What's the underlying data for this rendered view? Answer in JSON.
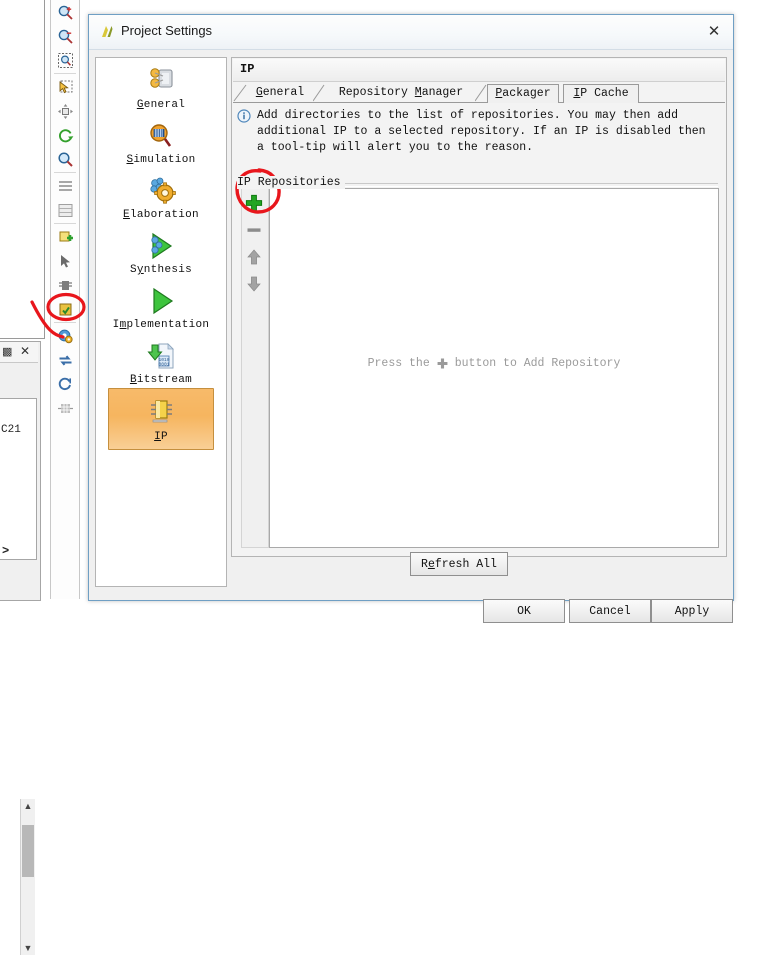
{
  "dialog": {
    "title": "Project Settings",
    "title_icon": "vivado-logo-icon",
    "close_icon": "close-icon",
    "buttons": {
      "ok": "OK",
      "cancel": "Cancel",
      "apply": "Apply"
    }
  },
  "categories": [
    {
      "label": "General",
      "label_html": "<u>G</u>eneral",
      "icon": "general-icon",
      "selected": false
    },
    {
      "label": "Simulation",
      "label_html": "<u>S</u>imulation",
      "icon": "simulation-icon",
      "selected": false
    },
    {
      "label": "Elaboration",
      "label_html": "<u>E</u>laboration",
      "icon": "elaboration-icon",
      "selected": false
    },
    {
      "label": "Synthesis",
      "label_html": "S<u>y</u>nthesis",
      "icon": "synthesis-icon",
      "selected": false
    },
    {
      "label": "Implementation",
      "label_html": "I<u>m</u>plementation",
      "icon": "implementation-icon",
      "selected": false
    },
    {
      "label": "Bitstream",
      "label_html": "<u>B</u>itstream",
      "icon": "bitstream-icon",
      "selected": false
    },
    {
      "label": "IP",
      "label_html": "<u>I</u>P",
      "icon": "ip-icon",
      "selected": true
    }
  ],
  "content": {
    "header_title": "IP",
    "tabs": [
      {
        "label": "General",
        "label_html": "<u>G</u>eneral",
        "active": false
      },
      {
        "label": "Repository Manager",
        "label_html": "Repository <u>M</u>anager",
        "active": true
      },
      {
        "label": "Packager",
        "label_html": "<u>P</u>ackager",
        "active": false
      },
      {
        "label": "IP Cache",
        "label_html": "<u>I</u>P Cache",
        "active": false
      }
    ],
    "info_icon": "info-icon",
    "info_text": "Add directories to the list of repositories. You may then add additional IP to a selected repository. If an IP is disabled then a tool-tip will alert you to the reason.",
    "group_label": "IP Repositories",
    "toolbar": [
      {
        "name": "add-repository-button",
        "icon": "plus-icon",
        "color": "#22a522",
        "enabled": true
      },
      {
        "name": "remove-repository-button",
        "icon": "minus-icon",
        "color": "#8c8c8c",
        "enabled": false
      },
      {
        "name": "move-up-button",
        "icon": "arrow-up-icon",
        "color": "#9a9a9a",
        "enabled": false
      },
      {
        "name": "move-down-button",
        "icon": "arrow-down-icon",
        "color": "#9a9a9a",
        "enabled": false
      }
    ],
    "empty_message_prefix": "Press the",
    "empty_message_icon": "plus-icon",
    "empty_message_suffix": "button to Add Repository",
    "refresh_button": "Refresh All",
    "refresh_button_html": "R<u>e</u>fresh All"
  },
  "background": {
    "toolbar_icons": [
      "zoom-in-icon",
      "zoom-out-icon",
      "zoom-fit-icon",
      "select-area-icon",
      "expand-all-icon",
      "refresh-icon",
      "search-icon",
      "list-view-icon",
      "table-view-icon",
      "add-module-icon",
      "pointer-icon",
      "hierarchy-icon",
      "highlight-icon",
      "settings-gear-icon",
      "swap-icon",
      "reload-icon",
      "grid-icon"
    ],
    "panel_close_icon": "close-icon",
    "panel_tab_icon": "panel-icon",
    "code_fragment": "C21",
    "arrow_fragment": ">",
    "scroll_up_icon": "chevron-up-icon",
    "scroll_down_icon": "chevron-down-icon"
  },
  "annotations": {
    "color": "#e8161c",
    "items": [
      {
        "name": "annotation-circle-add-button",
        "shape": "hand-drawn-ellipse"
      },
      {
        "name": "annotation-circle-settings-icon",
        "shape": "hand-drawn-ellipse"
      },
      {
        "name": "annotation-check-mark",
        "shape": "hand-drawn-check"
      }
    ]
  }
}
